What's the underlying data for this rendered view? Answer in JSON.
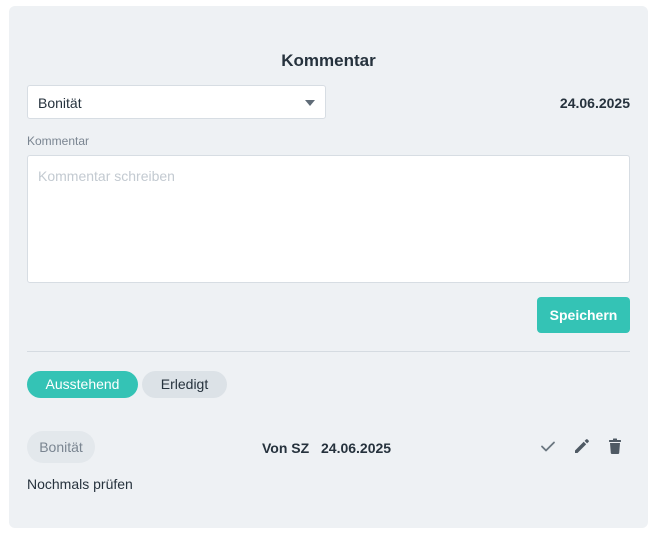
{
  "comment_form": {
    "title": "Kommentar",
    "category_selected": "Bonität",
    "date": "24.06.2025",
    "field_label": "Kommentar",
    "textarea_placeholder": "Kommentar schreiben",
    "textarea_value": "",
    "save_label": "Speichern"
  },
  "tabs": [
    {
      "label": "Ausstehend",
      "active": true
    },
    {
      "label": "Erledigt",
      "active": false
    }
  ],
  "entries": [
    {
      "category": "Bonität",
      "author": "Von SZ",
      "date": "24.06.2025",
      "text": "Nochmals prüfen",
      "actions": [
        "check-icon",
        "pencil-icon",
        "trash-icon"
      ]
    }
  ],
  "colors": {
    "accent": "#34c3b5",
    "panel_bg": "#eef1f4",
    "text": "#26323d",
    "muted": "#7a8591"
  }
}
